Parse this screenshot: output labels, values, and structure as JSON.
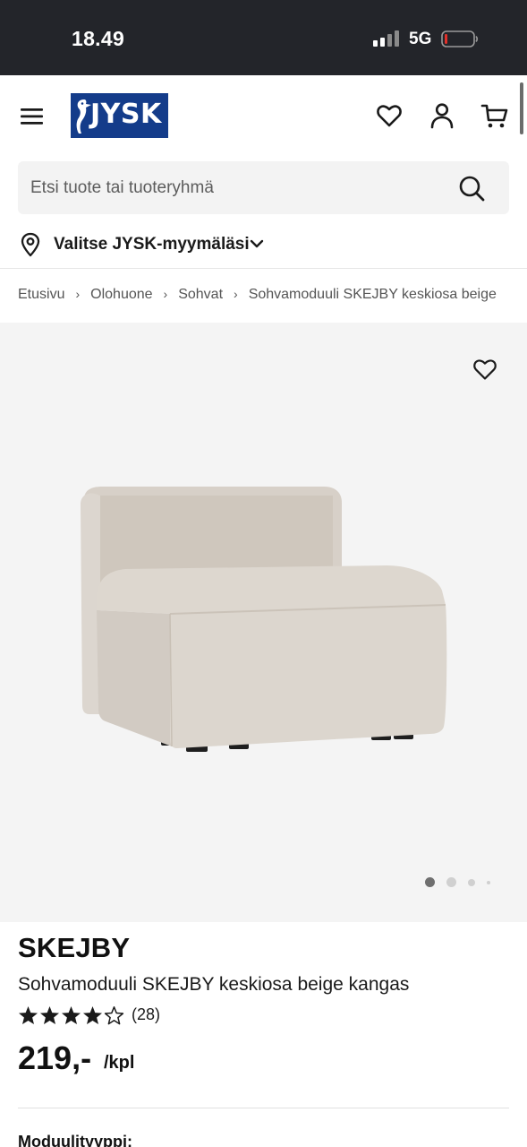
{
  "status_bar": {
    "time": "18.49",
    "network": "5G"
  },
  "header": {
    "logo_text": "JYSK",
    "icons": [
      "menu-icon",
      "heart-icon",
      "user-icon",
      "cart-icon"
    ]
  },
  "search": {
    "placeholder": "Etsi tuote tai tuoteryhmä"
  },
  "store": {
    "label": "Valitse JYSK-myymäläsi"
  },
  "breadcrumb": [
    "Etusivu",
    "Olohuone",
    "Sohvat",
    "Sohvamoduuli SKEJBY keskiosa beige"
  ],
  "gallery": {
    "image_count": 4,
    "active_index": 0
  },
  "product": {
    "brand": "SKEJBY",
    "name": "Sohvamoduuli SKEJBY keskiosa beige kangas",
    "rating": 4,
    "rating_max": 5,
    "review_count": "(28)",
    "price": "219,-",
    "unit": "/kpl",
    "module_type_label": "Moduulityyppi:"
  },
  "colors": {
    "brand_blue": "#143c8a",
    "status_bar": "#23252a",
    "gallery_bg": "#f4f4f4",
    "battery_low": "#e0302a"
  }
}
